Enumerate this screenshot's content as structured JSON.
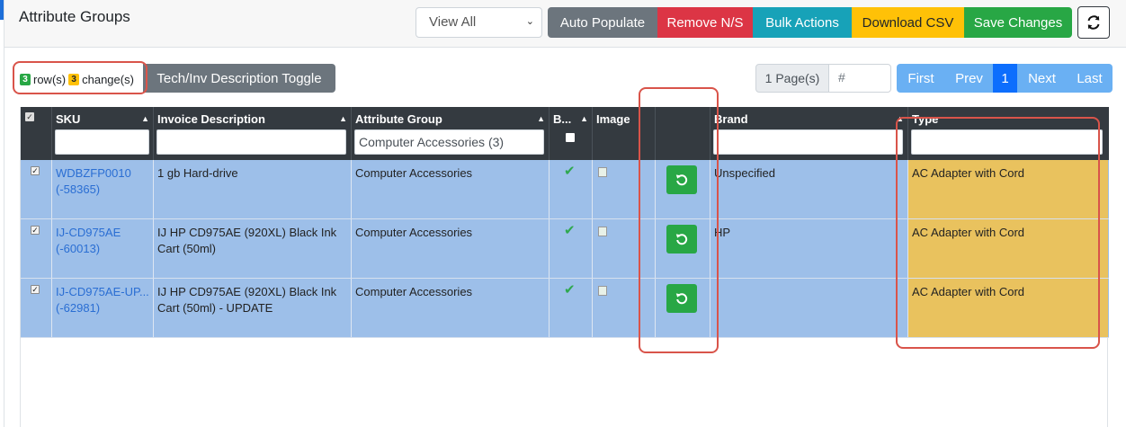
{
  "header": {
    "title": "Attribute Groups",
    "view_select": "View All",
    "buttons": {
      "auto_populate": "Auto Populate",
      "remove_ns": "Remove N/S",
      "bulk_actions": "Bulk Actions",
      "download_csv": "Download CSV",
      "save_changes": "Save Changes"
    },
    "refresh_icon": "refresh-icon"
  },
  "toolbar": {
    "rows_count": "3",
    "rows_label": "row(s)",
    "changes_count": "3",
    "changes_label": "change(s)",
    "toggle_label": "Tech/Inv Description Toggle"
  },
  "pagination": {
    "pages_label": "1 Page(s)",
    "page_input_placeholder": "#",
    "first": "First",
    "prev": "Prev",
    "current": "1",
    "next": "Next",
    "last": "Last"
  },
  "table": {
    "columns": {
      "sku": "SKU",
      "invoice_description": "Invoice Description",
      "attribute_group": "Attribute Group",
      "b": "B...",
      "image": "Image",
      "brand": "Brand",
      "type": "Type"
    },
    "filters": {
      "attribute_group": "Computer Accessories (3)"
    },
    "rows": [
      {
        "sku": "WDBZFP0010",
        "sku_id": "(-58365)",
        "invoice_description": "1 gb Hard-drive",
        "attribute_group": "Computer Accessories",
        "brand": "Unspecified",
        "type": "AC Adapter with Cord"
      },
      {
        "sku": "IJ-CD975AE",
        "sku_id": "(-60013)",
        "invoice_description": "IJ HP CD975AE (920XL) Black Ink Cart (50ml)",
        "attribute_group": "Computer Accessories",
        "brand": "HP",
        "type": "AC Adapter with Cord"
      },
      {
        "sku": "IJ-CD975AE-UP...",
        "sku_id": "(-62981)",
        "invoice_description": "IJ HP CD975AE (920XL) Black Ink Cart (50ml) - UPDATE",
        "attribute_group": "Computer Accessories",
        "brand": "",
        "type": "AC Adapter with Cord"
      }
    ]
  },
  "colors": {
    "row_selected": "#9dbfe9",
    "type_changed": "#e9c25e",
    "annotation": "#d9544a"
  }
}
